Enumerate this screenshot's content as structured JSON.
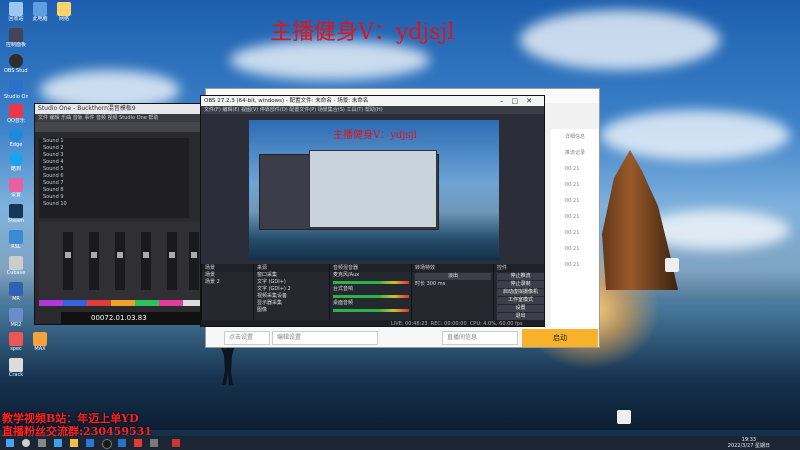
{
  "overlay": {
    "top_title": "主播健身V：ydjsjl",
    "bottom_line1": "教学视频B站：年迈上单YD",
    "bottom_line2": "直播粉丝交流群:230459531"
  },
  "studio": {
    "title": "Studio One - Buckthorn混音模板9",
    "menu": "文件  编辑  乐曲  音轨  事件  音频  视频  Studio One  帮助",
    "tracks": [
      "Sound 1",
      "Sound 2",
      "Sound 3",
      "Sound 4",
      "Sound 5",
      "Sound 6",
      "Sound 7",
      "Sound 8",
      "Sound 9",
      "Sound 10"
    ],
    "time": "00072.01.03.83"
  },
  "obs": {
    "title": "OBS 27.2.3 (64-bit, windows) - 配置文件: 未命名 - 场景: 未命名",
    "menu": "文件(F)  编辑(E)  视图(V)  停靠部件(D)  配置文件(P)  场景集合(S)  工具(T)  帮助(H)",
    "preview_title": "主播健身V：ydjsjl",
    "docks": {
      "scenes": {
        "header": "场景",
        "items": [
          "场景",
          "场景 2"
        ]
      },
      "sources": {
        "header": "来源",
        "items": [
          "窗口采集",
          "文字 (GDI+)",
          "文字 (GDI+) 2",
          "视频采集设备",
          "显示器采集",
          "图像"
        ]
      },
      "mixer": {
        "header": "音频混音器",
        "items": [
          "麦克风/Aux",
          "台式音响",
          "桌面音频"
        ],
        "db": [
          "0.0 dB",
          "0.0 dB",
          "0.0 dB"
        ]
      },
      "transitions": {
        "header": "转场特效",
        "fade": "淡出",
        "duration_label": "时长",
        "duration": "300 ms"
      },
      "controls": {
        "header": "控件",
        "buttons": [
          "停止推流",
          "停止录制",
          "启动虚拟摄像机",
          "工作室模式",
          "设置",
          "退出"
        ]
      }
    },
    "status": [
      "LIVE: 00:48:23",
      "REC: 00:00:00",
      "CPU: 4.0%, 60.00 fps"
    ]
  },
  "obs_back": {
    "side_items": [
      "详细信息",
      "推流记录",
      "00:21",
      "00:21",
      "00:21",
      "00:21",
      "00:21",
      "00:21",
      "00:21"
    ],
    "field1": "点击设置",
    "field2": "编辑设置",
    "field3": "直播间信息",
    "start_label": "启动"
  },
  "desktop_icons": [
    "回收站",
    "此电脑",
    "网络",
    "控制面板",
    "OBS Studio",
    "Studio One",
    "QQ音乐",
    "Edge",
    "酷狗",
    "设置",
    "Steam",
    "RSL",
    "Cubase",
    "MR",
    "MR2",
    "spec",
    "MAX",
    "Crack"
  ],
  "taskbar": {
    "time": "19:33",
    "date": "2022/3/27 星期日"
  }
}
